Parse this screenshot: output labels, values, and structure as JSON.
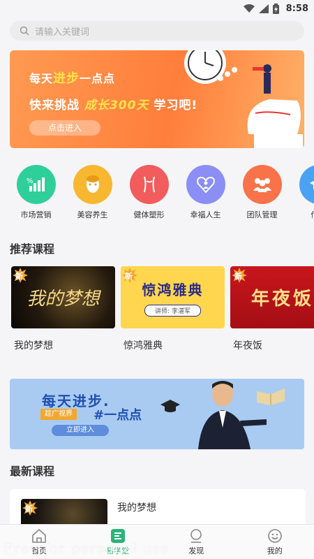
{
  "status_bar": {
    "time": "8:58"
  },
  "search": {
    "placeholder": "请输入关键词"
  },
  "banner_top": {
    "line1_prefix": "每天",
    "line1_highlight": "进步",
    "line1_suffix": "一点点",
    "line2_prefix": "快来挑战",
    "line2_highlight": "成长300天",
    "line2_suffix": "学习吧!",
    "cta": "点击进入"
  },
  "categories": [
    {
      "label": "市场营销",
      "icon": "chart-up-icon",
      "color": "#2fcf9a"
    },
    {
      "label": "美容养生",
      "icon": "face-mask-icon",
      "color": "#f7b731"
    },
    {
      "label": "健体塑形",
      "icon": "body-shape-icon",
      "color": "#f25c5c"
    },
    {
      "label": "幸福人生",
      "icon": "heart-person-icon",
      "color": "#8a8ef5"
    },
    {
      "label": "团队管理",
      "icon": "team-icon",
      "color": "#f8724a"
    },
    {
      "label": "传统",
      "icon": "graduation-cap-icon",
      "color": "#4aa3f2"
    }
  ],
  "recommended": {
    "title": "推荐课程",
    "badge": "新",
    "courses": [
      {
        "name": "我的梦想",
        "thumb_text": "我的梦想"
      },
      {
        "name": "惊鸿雅典",
        "thumb_text": "惊鸿雅典",
        "thumb_sub": "讲师: 李湛军"
      },
      {
        "name": "年夜饭",
        "thumb_text": "年夜饭"
      }
    ]
  },
  "banner_mid": {
    "line1": "每天进步.",
    "chip": "趁广视界",
    "line2": "#一点点",
    "cta": "立即进入"
  },
  "latest": {
    "title": "最新课程",
    "courses": [
      {
        "name": "我的梦想"
      }
    ]
  },
  "tabbar": {
    "tabs": [
      {
        "label": "首页",
        "icon": "home-icon",
        "active": false
      },
      {
        "label": "易学堂",
        "icon": "book-icon",
        "active": true
      },
      {
        "label": "发现",
        "icon": "discover-icon",
        "active": false
      },
      {
        "label": "我的",
        "icon": "smile-icon",
        "active": false
      }
    ]
  },
  "watermark": "Free for personal use",
  "colors": {
    "accent": "#2db37a",
    "banner_orange": "#ff8a45",
    "banner_blue": "#a9cbf2"
  }
}
